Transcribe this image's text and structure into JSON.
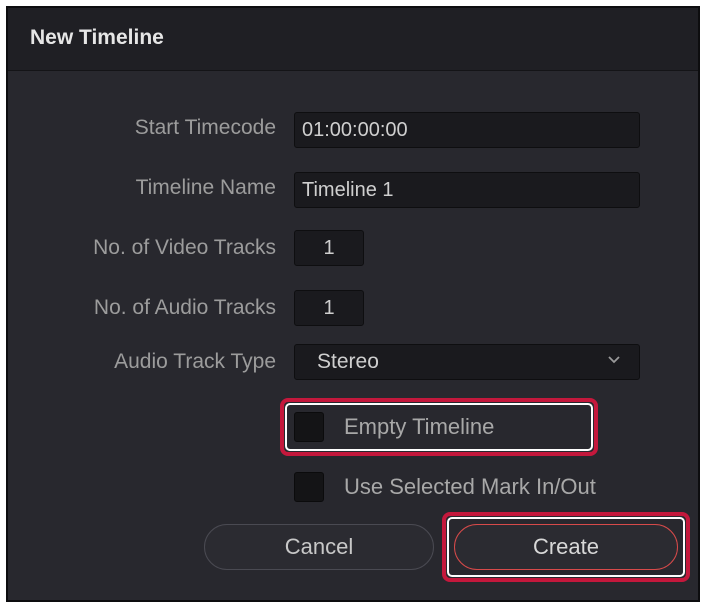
{
  "dialog": {
    "title": "New Timeline",
    "fields": {
      "start_timecode": {
        "label": "Start Timecode",
        "value": "01:00:00:00"
      },
      "timeline_name": {
        "label": "Timeline Name",
        "value": "Timeline 1"
      },
      "video_tracks": {
        "label": "No. of Video Tracks",
        "value": "1"
      },
      "audio_tracks": {
        "label": "No. of Audio Tracks",
        "value": "1"
      },
      "audio_track_type": {
        "label": "Audio Track Type",
        "value": "Stereo"
      }
    },
    "checkboxes": {
      "empty_timeline": {
        "label": "Empty Timeline",
        "checked": false
      },
      "use_mark": {
        "label": "Use Selected Mark In/Out",
        "checked": false
      }
    },
    "buttons": {
      "cancel": "Cancel",
      "create": "Create"
    }
  },
  "colors": {
    "highlight": "#c4183c",
    "panel": "#28282e",
    "titlebar": "#1f1f24"
  }
}
